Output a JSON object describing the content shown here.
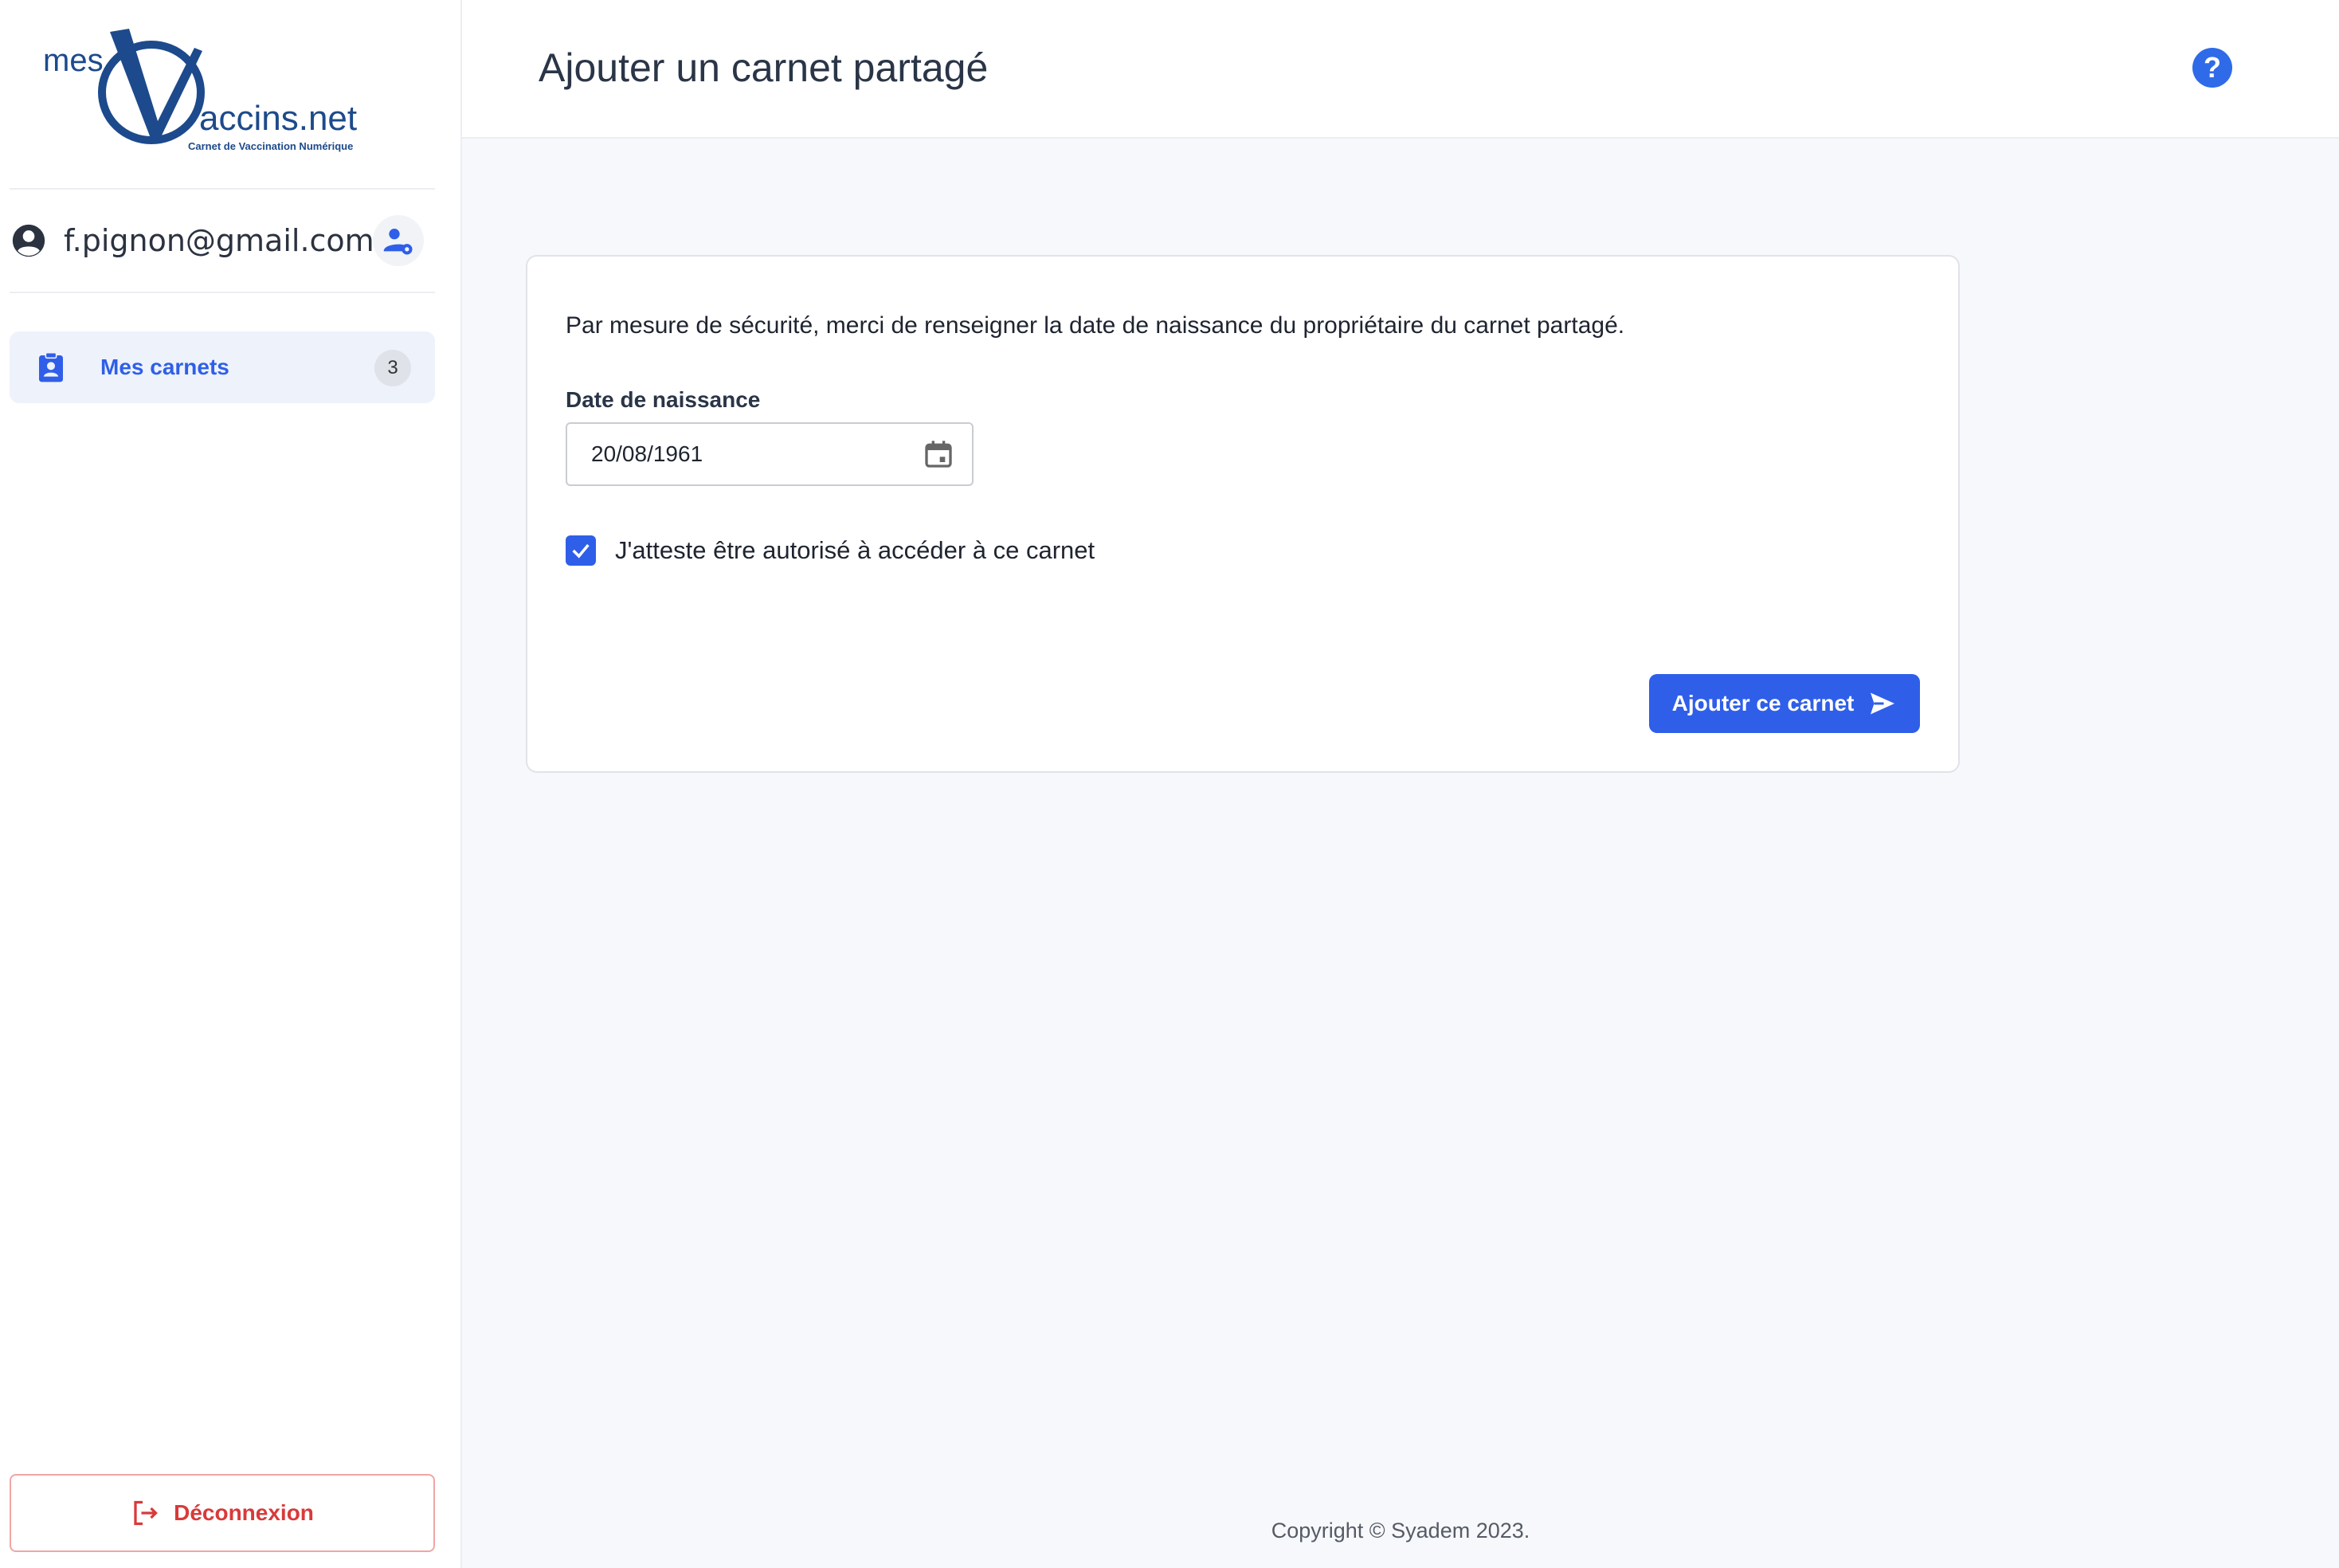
{
  "logo": {
    "mes": "mes",
    "accins": "accins.net",
    "tagline": "Carnet de Vaccination Numérique"
  },
  "user": {
    "email": "f.pignon@gmail.com"
  },
  "nav": {
    "items": [
      {
        "label": "Mes carnets",
        "count": "3",
        "icon": "clipboard-user-icon"
      }
    ]
  },
  "logout": {
    "label": "Déconnexion"
  },
  "header": {
    "title": "Ajouter un carnet partagé",
    "help_label": "?"
  },
  "form": {
    "intro": "Par mesure de sécurité, merci de renseigner la date de naissance du propriétaire du carnet partagé.",
    "date_label": "Date de naissance",
    "date_value": "20/08/1961",
    "attest_label": "J'atteste être autorisé à accéder à ce carnet",
    "attest_checked": true,
    "submit_label": "Ajouter ce carnet"
  },
  "footer": {
    "copyright": "Copyright © Syadem 2023."
  },
  "colors": {
    "accent": "#2f5fe8",
    "brand": "#1d4a8c",
    "danger": "#d93a3a"
  }
}
